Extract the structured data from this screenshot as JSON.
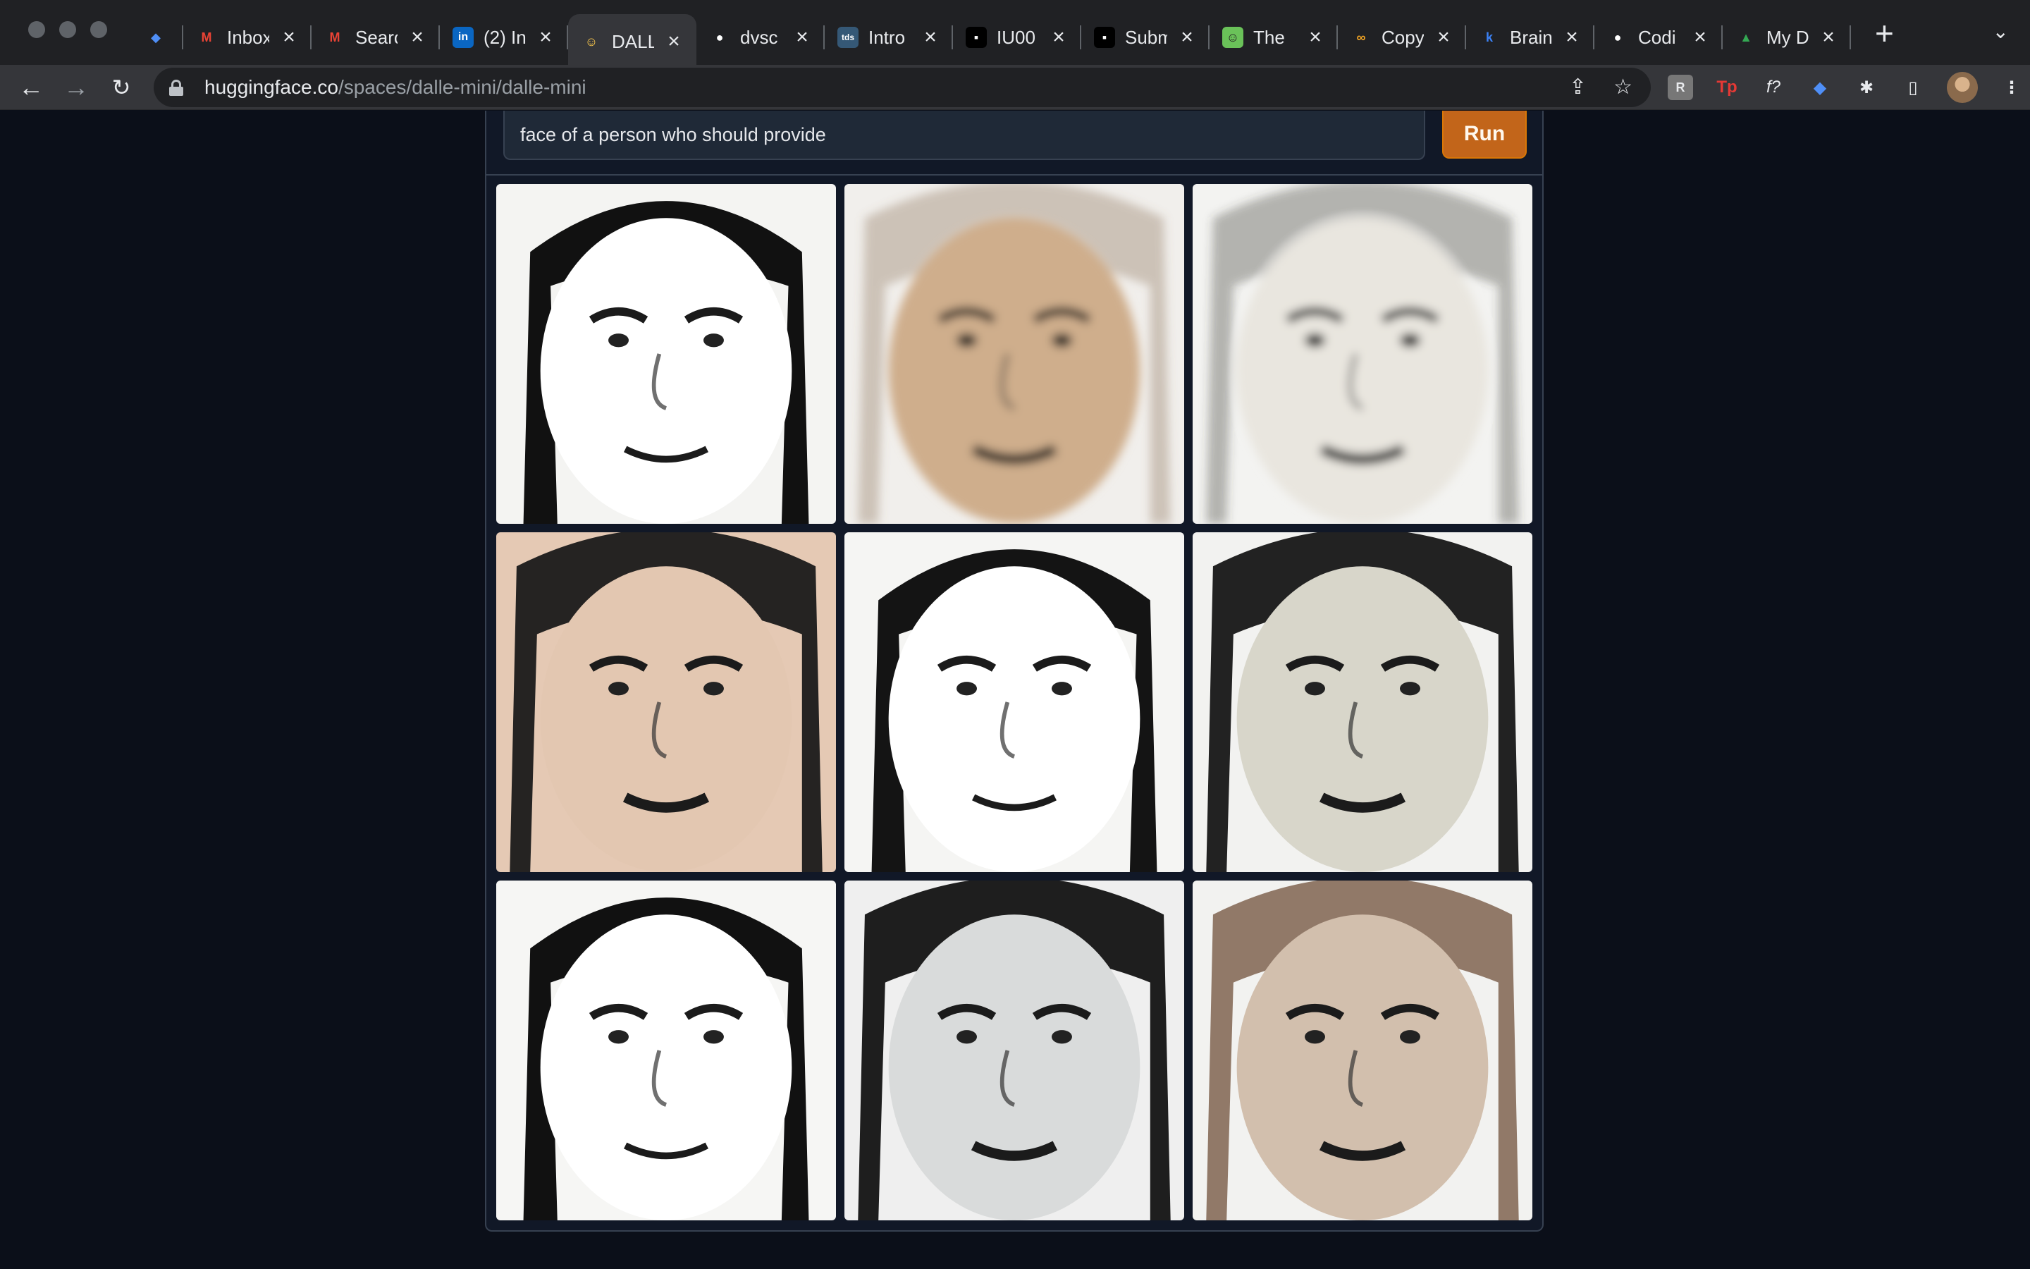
{
  "browser": {
    "tabs": [
      {
        "title": "",
        "icon": "diamond-icon",
        "color": "#4f8ff7",
        "pinned": true
      },
      {
        "title": "Inbox",
        "icon": "gmail-icon",
        "color": "#ea4335"
      },
      {
        "title": "Search",
        "icon": "gmail-icon",
        "color": "#ea4335"
      },
      {
        "title": "(2) In",
        "icon": "linkedin-icon",
        "color": "#0a66c2"
      },
      {
        "title": "DALL",
        "icon": "huggingface-icon",
        "color": "#ffcc4d",
        "active": true
      },
      {
        "title": "dvsc",
        "icon": "github-icon",
        "color": "#ffffff"
      },
      {
        "title": "Intro",
        "icon": "tds-icon",
        "color": "#355876"
      },
      {
        "title": "IU00",
        "icon": "app-icon",
        "color": "#000000"
      },
      {
        "title": "Subm",
        "icon": "app-icon",
        "color": "#000000"
      },
      {
        "title": "The",
        "icon": "smile-icon",
        "color": "#6ac259"
      },
      {
        "title": "Copy",
        "icon": "infinity-icon",
        "color": "#f5a623"
      },
      {
        "title": "Brain",
        "icon": "k-icon",
        "color": "#3b82f6"
      },
      {
        "title": "Codi",
        "icon": "github-icon",
        "color": "#ffffff"
      },
      {
        "title": "My D",
        "icon": "drive-icon",
        "color": "#34a853"
      }
    ],
    "url_host": "huggingface.co",
    "url_path": "/spaces/dalle-mini/dalle-mini"
  },
  "app": {
    "prompt_value": "face of a person who should provide",
    "run_label": "Run",
    "images": [
      {
        "bg": "#f4f4f2",
        "skin": "#ffffff",
        "hair": "#111111",
        "style": "line"
      },
      {
        "bg": "#f1efec",
        "skin": "#cfae8c",
        "hair": "#8a6c53",
        "style": "blur"
      },
      {
        "bg": "#f3f3f1",
        "skin": "#e9e6df",
        "hair": "#3a3834",
        "style": "blur"
      },
      {
        "bg": "#e5c9b4",
        "skin": "#e3c7b1",
        "hair": "#1a1a1a",
        "style": "flat"
      },
      {
        "bg": "#f5f5f3",
        "skin": "#ffffff",
        "hair": "#141414",
        "style": "line"
      },
      {
        "bg": "#f2f2f0",
        "skin": "#d8d6ca",
        "hair": "#161616",
        "style": "flat"
      },
      {
        "bg": "#f6f6f4",
        "skin": "#ffffff",
        "hair": "#111111",
        "style": "line"
      },
      {
        "bg": "#efefef",
        "skin": "#d9dbdb",
        "hair": "#121212",
        "style": "flat"
      },
      {
        "bg": "#f2f2f0",
        "skin": "#d2bfad",
        "hair": "#8b7260",
        "style": "flat"
      }
    ]
  }
}
